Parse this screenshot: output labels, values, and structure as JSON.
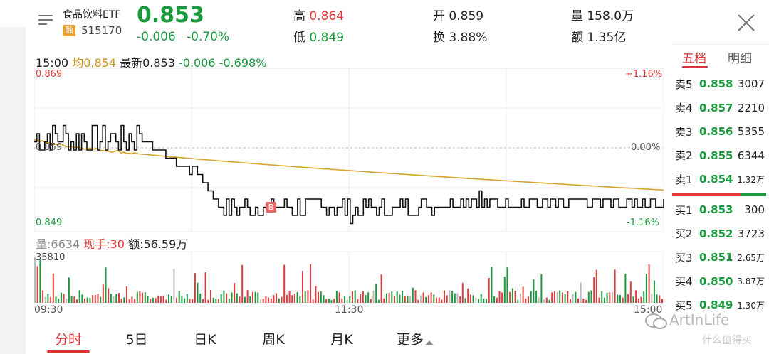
{
  "header": {
    "name": "食品饮料ETF",
    "badge": "融",
    "code": "515170",
    "price": "0.853",
    "change": "-0.006",
    "change_pct": "-0.70%",
    "stats": [
      {
        "label": "高",
        "value": "0.864",
        "color": "red"
      },
      {
        "label": "开",
        "value": "0.859",
        "color": "black"
      },
      {
        "label": "量",
        "value": "158.0万",
        "color": "black"
      },
      {
        "label": "低",
        "value": "0.849",
        "color": "green"
      },
      {
        "label": "换",
        "value": "3.88%",
        "color": "black"
      },
      {
        "label": "额",
        "value": "1.35亿",
        "color": "black"
      }
    ]
  },
  "info_bar": {
    "time": "15:00",
    "avg": "均0.854",
    "latest": "最新0.853",
    "change": "-0.006",
    "change_pct": "-0.698%"
  },
  "price_axis": {
    "top_price": "0.869",
    "mid_price": "0.859",
    "bottom_price": "0.849",
    "top_pct": "+1.16%",
    "mid_pct": "0.00%",
    "bottom_pct": "-1.16%",
    "marker": "B"
  },
  "volume_bar": {
    "vol": "量:6634",
    "now_hand": "现手:30",
    "amount": "额:56.59万",
    "max": "35810"
  },
  "time_axis": [
    "09:30",
    "11:30",
    "15:00"
  ],
  "orderbook": {
    "tabs": [
      "五档",
      "明细"
    ],
    "asks": [
      {
        "label": "卖5",
        "price": "0.858",
        "vol": "3007"
      },
      {
        "label": "卖4",
        "price": "0.857",
        "vol": "2210"
      },
      {
        "label": "卖3",
        "price": "0.856",
        "vol": "5355"
      },
      {
        "label": "卖2",
        "price": "0.855",
        "vol": "6344"
      },
      {
        "label": "卖1",
        "price": "0.854",
        "vol": "1.32万"
      }
    ],
    "bids": [
      {
        "label": "买1",
        "price": "0.853",
        "vol": "300"
      },
      {
        "label": "买2",
        "price": "0.852",
        "vol": "3723"
      },
      {
        "label": "买3",
        "price": "0.851",
        "vol": "2.65万"
      },
      {
        "label": "买4",
        "price": "0.850",
        "vol": "3.87万"
      },
      {
        "label": "买5",
        "price": "0.849",
        "vol": "1.30万"
      }
    ]
  },
  "bottom_tabs": [
    "分时",
    "5日",
    "日K",
    "周K",
    "月K",
    "更多"
  ],
  "watermark": "ArtInLife",
  "watermark_sub": "什么值得买",
  "colors": {
    "up": "#e23b3b",
    "down": "#1a9a3c",
    "avg_line": "#d4a42a",
    "price_line": "#111111"
  }
}
